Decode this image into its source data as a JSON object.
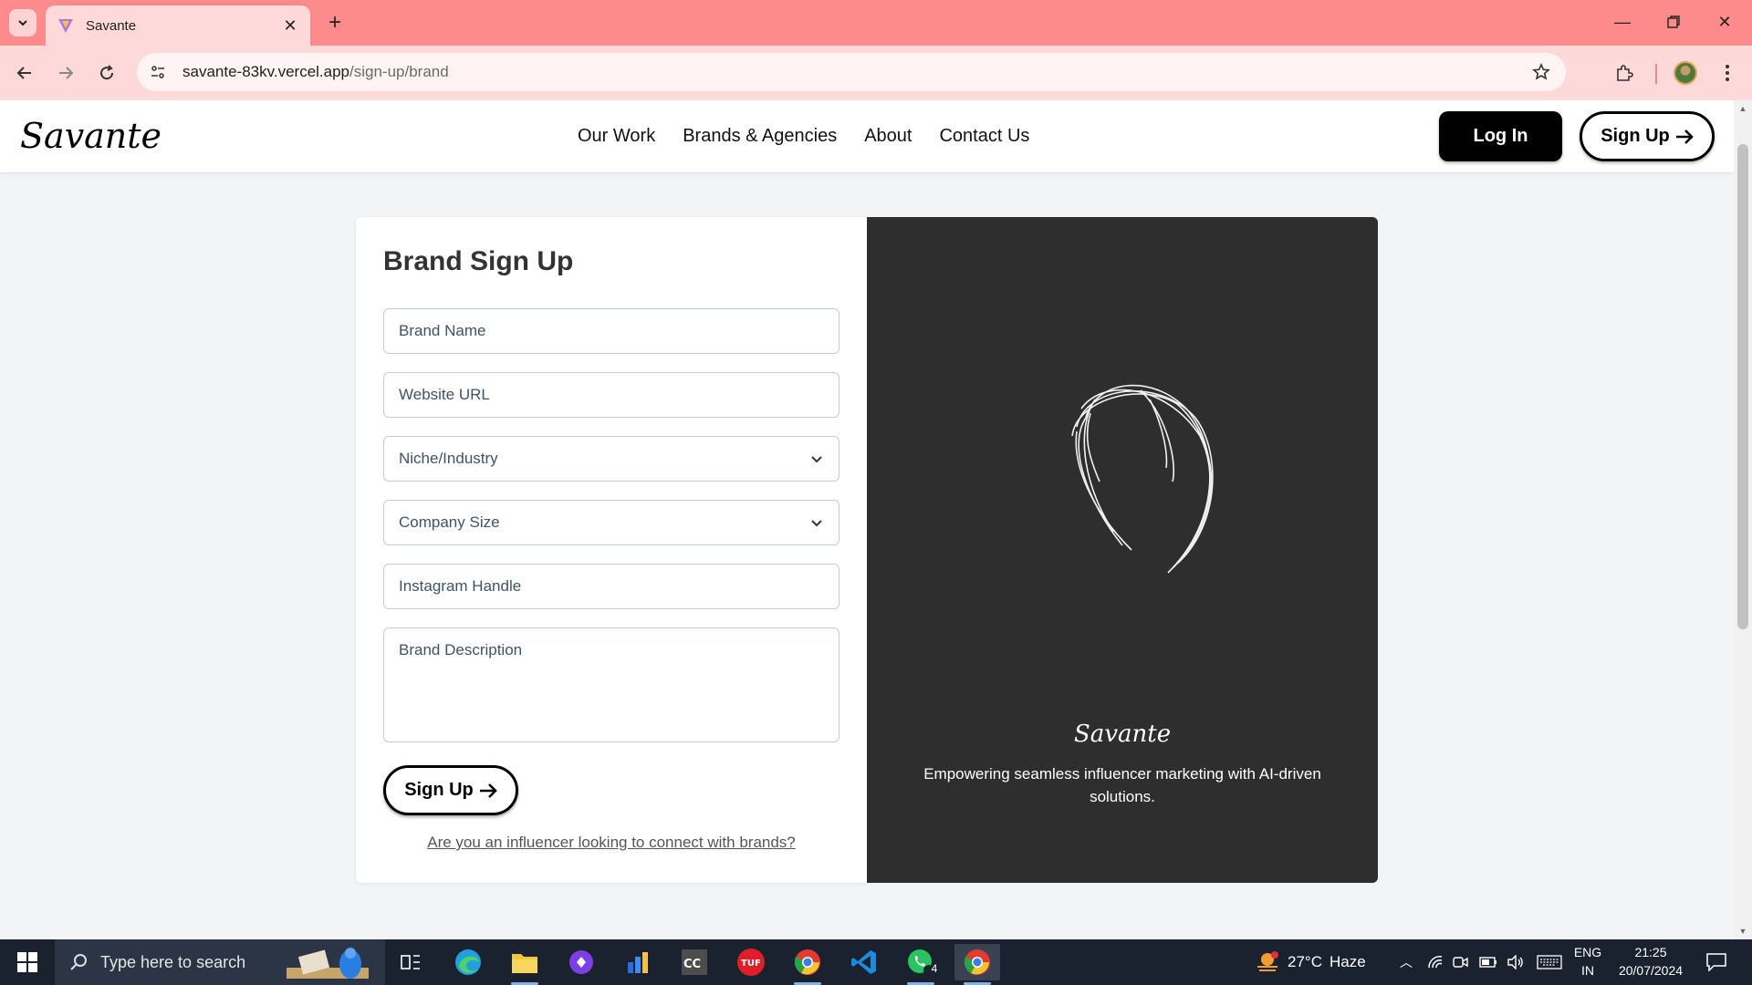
{
  "browser": {
    "tab_title": "Savante",
    "url_host": "savante-83kv.vercel.app",
    "url_path": "/sign-up/brand"
  },
  "site": {
    "logo_text": "Savante",
    "nav": [
      "Our Work",
      "Brands & Agencies",
      "About",
      "Contact Us"
    ],
    "login_label": "Log In",
    "signup_label": "Sign Up"
  },
  "form": {
    "title": "Brand Sign Up",
    "brand_name_placeholder": "Brand Name",
    "website_placeholder": "Website URL",
    "niche_placeholder": "Niche/Industry",
    "company_size_placeholder": "Company Size",
    "instagram_placeholder": "Instagram Handle",
    "description_placeholder": "Brand Description",
    "submit_label": "Sign Up",
    "influencer_link": "Are you an influencer looking to connect with brands?"
  },
  "promo": {
    "logo_text": "Savante",
    "tagline": "Empowering seamless influencer marketing with AI-driven solutions."
  },
  "taskbar": {
    "search_placeholder": "Type here to search",
    "weather_temp": "27°C",
    "weather_desc": "Haze",
    "weather_alerts": "1",
    "whatsapp_badge": "4",
    "language": "ENG",
    "region": "IN",
    "time": "21:25",
    "date": "20/07/2024"
  },
  "colors": {
    "chrome_tabstrip": "#fd8b8b",
    "chrome_toolbar": "#fdd9d9",
    "promo_panel": "#2e2e2e",
    "primary_button": "#000000"
  }
}
